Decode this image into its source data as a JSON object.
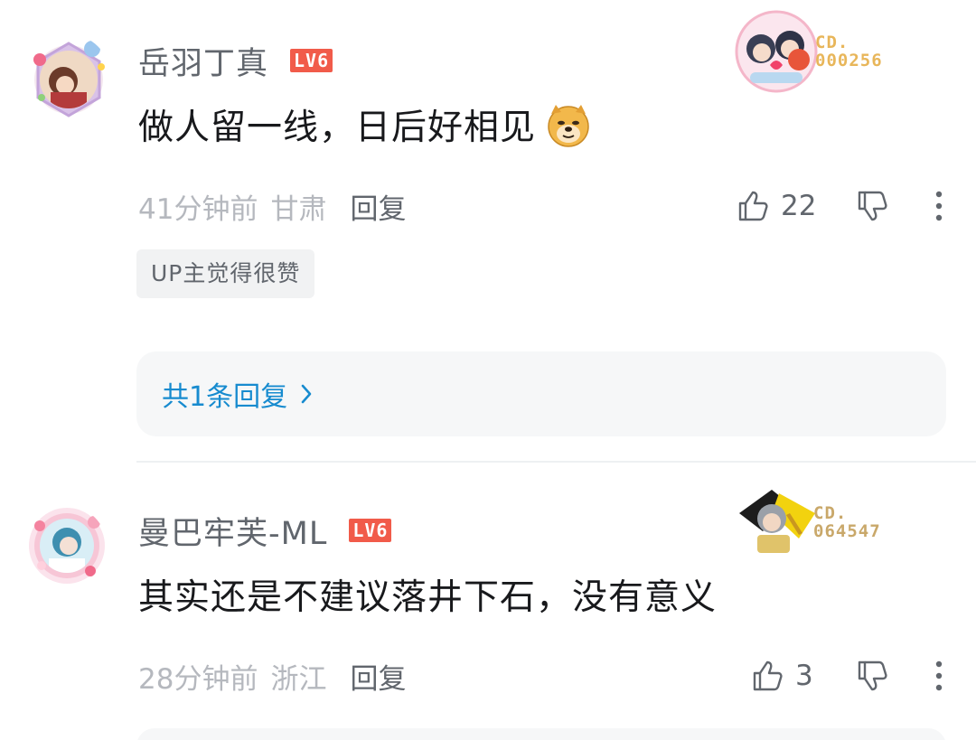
{
  "comments": [
    {
      "username": "岳羽丁真",
      "level": "LV6",
      "fan_no_prefix": "CD.",
      "fan_no": "000256",
      "content": "做人留一线，日后好相见",
      "emoji_icon": "doge-icon",
      "time": "41分钟前",
      "location": "甘肃",
      "reply_label": "回复",
      "likes": "22",
      "tag": "UP主觉得很赞",
      "replies_label": "共1条回复"
    },
    {
      "username": "曼巴牢芙-ML",
      "level": "LV6",
      "fan_no_prefix": "CD.",
      "fan_no": "064547",
      "content": "其实还是不建议落井下石，没有意义",
      "time": "28分钟前",
      "location": "浙江",
      "reply_label": "回复",
      "likes": "3"
    }
  ],
  "colors": {
    "level_badge": "#f15b4a",
    "link": "#178bcf",
    "fan_no_1": "#e8b65a",
    "fan_no_2": "#c9a86a"
  }
}
